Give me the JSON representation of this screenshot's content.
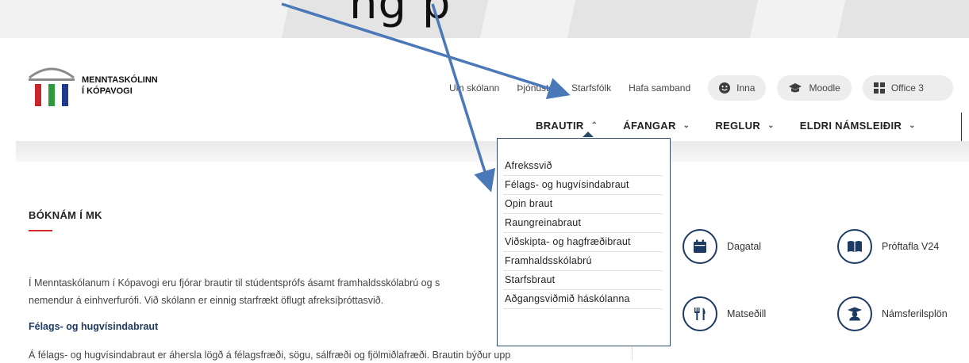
{
  "caption_text": "ng p",
  "brand": {
    "line1": "MENNTASKÓLINN",
    "line2": "Í KÓPAVOGI",
    "colors": {
      "red": "#c8262c",
      "green": "#2f9a3d",
      "blue": "#1d3b8a"
    }
  },
  "util_nav": {
    "links": [
      "Um skólann",
      "Þjónusta",
      "Starfsfólk",
      "Hafa samband"
    ],
    "pills": [
      {
        "label": "Inna",
        "icon": "smiley-icon"
      },
      {
        "label": "Moodle",
        "icon": "graduation-cap-icon"
      },
      {
        "label": "Office 3",
        "icon": "windows-grid-icon"
      }
    ]
  },
  "main_nav": {
    "items": [
      {
        "label": "BRAUTIR",
        "state": "open"
      },
      {
        "label": "ÁFANGAR",
        "state": "closed"
      },
      {
        "label": "REGLUR",
        "state": "closed"
      },
      {
        "label": "ELDRI NÁMSLEIÐIR",
        "state": "closed"
      }
    ]
  },
  "dropdown": {
    "items": [
      "Afrekssvið",
      "Félags- og hugvísindabraut",
      "Opin braut",
      "Raungreinabraut",
      "Viðskipta- og hagfræðibraut",
      "Framhaldsskólabrú",
      "Starfsbraut",
      "Aðgangsviðmið háskólanna"
    ]
  },
  "content": {
    "section_title": "BÓKNÁM Í MK",
    "intro_line1": "Í Menntaskólanum í Kópavogi eru fjórar brautir til stúdentsprófs ásamt framhaldsskólabrú og s",
    "intro_line2": "nemendur á einhverfurófi. Við skólann er einnig starfrækt öflugt afreksíþróttasvið.",
    "subheading": "Félags- og hugvísindabraut",
    "body_line": "Á félags- og hugvísindabraut er áhersla lögð á félagsfræði, sögu, sálfræði og fjölmiðlafræði. Brautin býður upp"
  },
  "quick_links": [
    {
      "label": "Dagatal",
      "icon": "calendar-icon"
    },
    {
      "label": "Próftafla V24",
      "icon": "book-icon"
    },
    {
      "label": "Matseðill",
      "icon": "utensils-icon"
    },
    {
      "label": "Námsferilsplön",
      "icon": "graduate-icon"
    }
  ],
  "annotation_color": "#4a78b8"
}
